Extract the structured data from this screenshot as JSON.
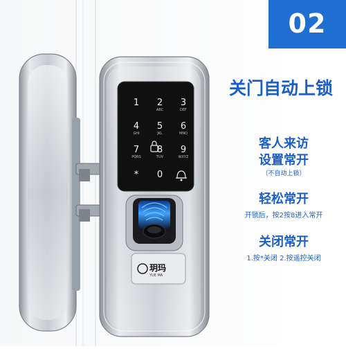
{
  "badge": {
    "number": "02",
    "subtitle": ""
  },
  "headline": "关门自动上锁",
  "features": [
    {
      "title": "客人来访",
      "title2": "设置常开",
      "note": "（不自动上锁）",
      "desc": ""
    },
    {
      "title": "轻松常开",
      "title2": "",
      "note": "",
      "desc": "开锁后，按2按8进入常开"
    },
    {
      "title": "关闭常开",
      "title2": "",
      "note": "",
      "desc": "1.按*关闭  2.按遥控关闭"
    }
  ],
  "keypad": {
    "keys": [
      {
        "digit": "1",
        "letters": ""
      },
      {
        "digit": "2",
        "letters": "ABC"
      },
      {
        "digit": "3",
        "letters": "DEF"
      },
      {
        "digit": "4",
        "letters": "GHI"
      },
      {
        "digit": "5",
        "letters": "JKL"
      },
      {
        "digit": "6",
        "letters": "MNO"
      },
      {
        "digit": "7",
        "letters": "PQRS"
      },
      {
        "digit": "8",
        "letters": "TUV"
      },
      {
        "digit": "9",
        "letters": "WXYZ"
      },
      {
        "digit": "*",
        "letters": ""
      },
      {
        "digit": "0",
        "letters": ""
      },
      {
        "digit": "",
        "letters": ""
      }
    ]
  },
  "brand": {
    "name": "玥玛",
    "sub": "YUE MA"
  },
  "colors": {
    "accent": "#1a5fc8",
    "badge": "#1e6fd1",
    "lock_body": "#c9ccd1",
    "panel": "#111111"
  },
  "icons": {
    "doorbell": "bell-icon",
    "fingerprint": "fingerprint-icon",
    "lock": "lock-icon"
  }
}
